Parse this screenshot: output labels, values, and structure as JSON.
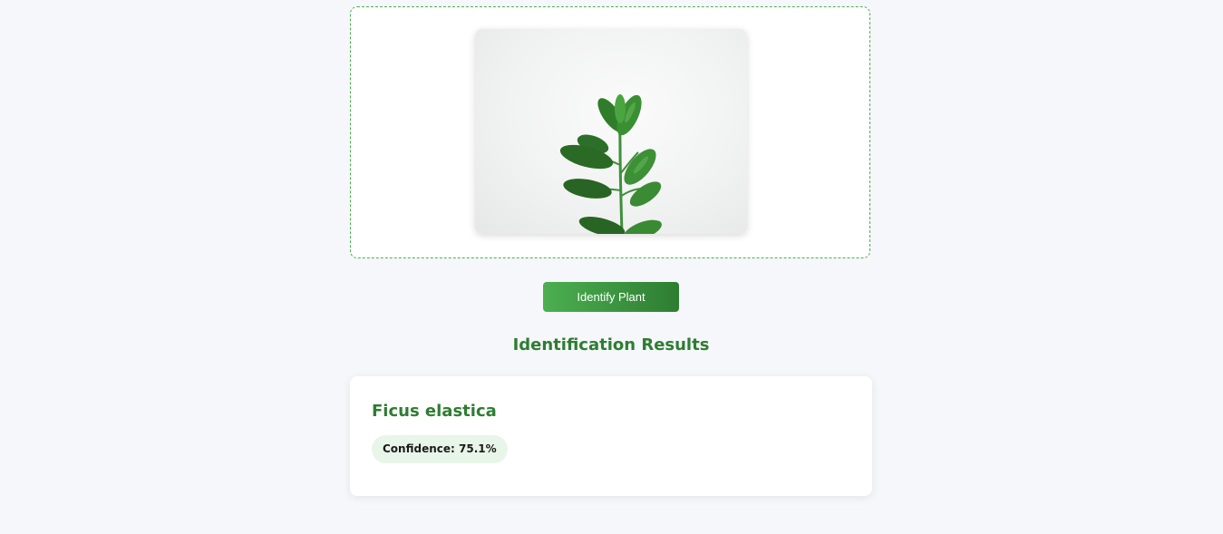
{
  "upload": {
    "image_alt": "Ficus elastica plant photo"
  },
  "actions": {
    "identify_label": "Identify Plant"
  },
  "results": {
    "title": "Identification Results",
    "items": [
      {
        "name": "Ficus elastica",
        "confidence_label": "Confidence: 75.1%"
      }
    ]
  },
  "colors": {
    "accent": "#2e7d32",
    "accent_light": "#4caf50",
    "badge_bg": "#e8f5e9",
    "page_bg": "#f5f7fa"
  }
}
